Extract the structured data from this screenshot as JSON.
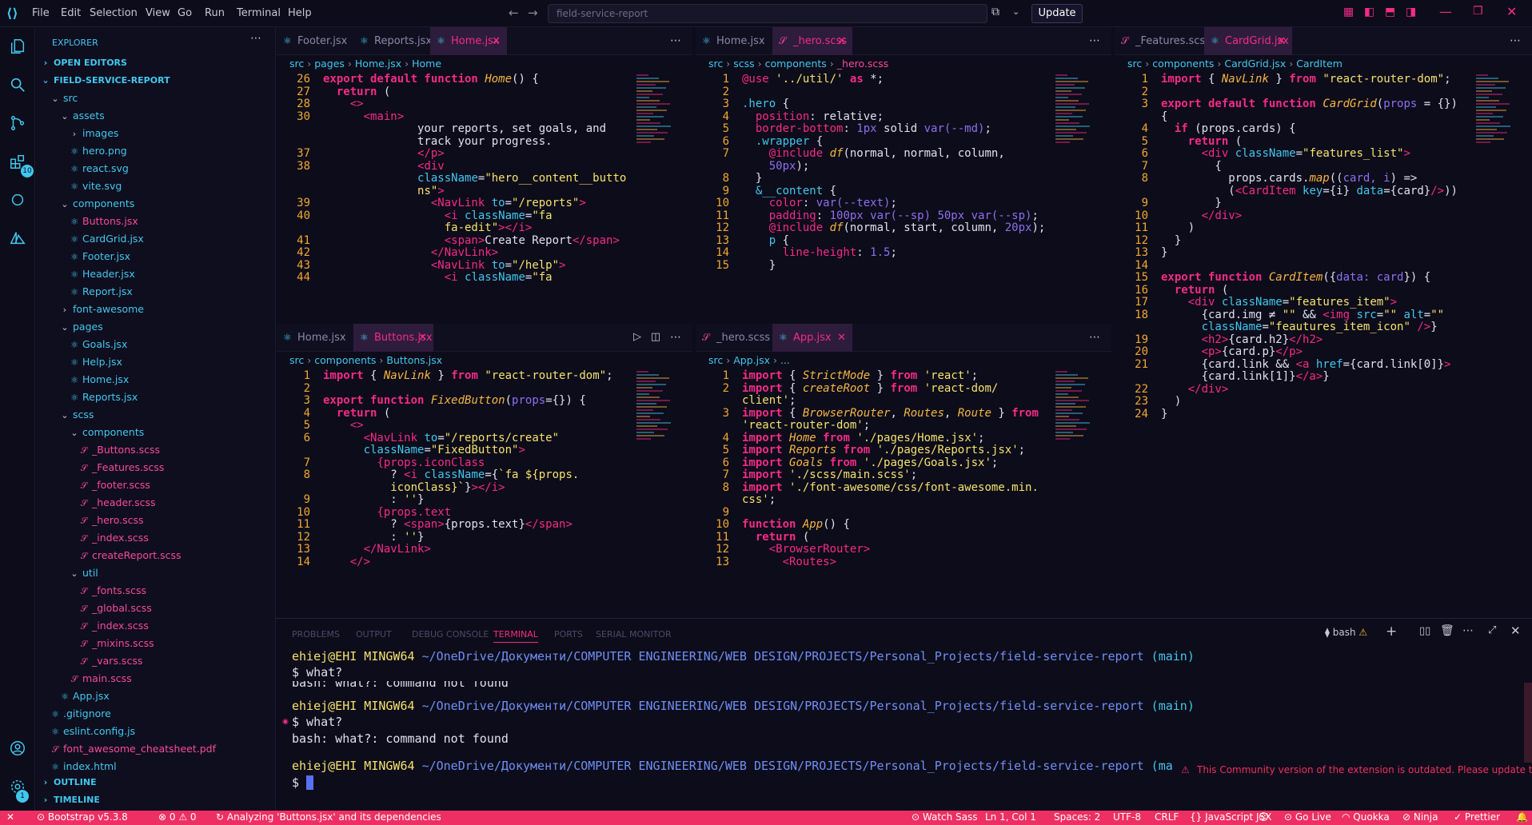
{
  "menu": [
    "File",
    "Edit",
    "Selection",
    "View",
    "Go",
    "Run",
    "Terminal",
    "Help"
  ],
  "search_placeholder": "field-service-report",
  "update_label": "Update",
  "explorer": {
    "title": "EXPLORER",
    "open_editors": "OPEN EDITORS",
    "project": "FIELD-SERVICE-REPORT",
    "items": [
      {
        "label": "src",
        "type": "folder",
        "open": true,
        "depth": 1
      },
      {
        "label": "assets",
        "type": "folder",
        "open": true,
        "depth": 2
      },
      {
        "label": "images",
        "type": "folder",
        "open": false,
        "depth": 3
      },
      {
        "label": "hero.png",
        "type": "file",
        "depth": 3
      },
      {
        "label": "react.svg",
        "type": "file",
        "depth": 3
      },
      {
        "label": "vite.svg",
        "type": "file",
        "depth": 3
      },
      {
        "label": "components",
        "type": "folder",
        "open": true,
        "depth": 2
      },
      {
        "label": "Buttons.jsx",
        "type": "active",
        "depth": 3
      },
      {
        "label": "CardGrid.jsx",
        "type": "file",
        "depth": 3
      },
      {
        "label": "Footer.jsx",
        "type": "file",
        "depth": 3
      },
      {
        "label": "Header.jsx",
        "type": "file",
        "depth": 3
      },
      {
        "label": "Report.jsx",
        "type": "file",
        "depth": 3
      },
      {
        "label": "font-awesome",
        "type": "folder",
        "open": false,
        "depth": 2
      },
      {
        "label": "pages",
        "type": "folder",
        "open": true,
        "depth": 2
      },
      {
        "label": "Goals.jsx",
        "type": "file",
        "depth": 3
      },
      {
        "label": "Help.jsx",
        "type": "file",
        "depth": 3
      },
      {
        "label": "Home.jsx",
        "type": "file",
        "depth": 3
      },
      {
        "label": "Reports.jsx",
        "type": "file",
        "depth": 3
      },
      {
        "label": "scss",
        "type": "folder",
        "open": true,
        "depth": 2
      },
      {
        "label": "components",
        "type": "folder",
        "open": true,
        "depth": 3
      },
      {
        "label": "_Buttons.scss",
        "type": "scss",
        "depth": 4
      },
      {
        "label": "_Features.scss",
        "type": "scss",
        "depth": 4
      },
      {
        "label": "_footer.scss",
        "type": "scss",
        "depth": 4
      },
      {
        "label": "_header.scss",
        "type": "scss",
        "depth": 4
      },
      {
        "label": "_hero.scss",
        "type": "scss",
        "depth": 4
      },
      {
        "label": "_index.scss",
        "type": "scss",
        "depth": 4
      },
      {
        "label": "createReport.scss",
        "type": "scss",
        "depth": 4
      },
      {
        "label": "util",
        "type": "folder",
        "open": true,
        "depth": 3
      },
      {
        "label": "_fonts.scss",
        "type": "scss",
        "depth": 4
      },
      {
        "label": "_global.scss",
        "type": "scss",
        "depth": 4
      },
      {
        "label": "_index.scss",
        "type": "scss",
        "depth": 4
      },
      {
        "label": "_mixins.scss",
        "type": "scss",
        "depth": 4
      },
      {
        "label": "_vars.scss",
        "type": "scss",
        "depth": 4
      },
      {
        "label": "main.scss",
        "type": "scss",
        "depth": 3
      },
      {
        "label": "App.jsx",
        "type": "file",
        "depth": 2
      },
      {
        "label": ".gitignore",
        "type": "file",
        "depth": 1
      },
      {
        "label": "eslint.config.js",
        "type": "file",
        "depth": 1
      },
      {
        "label": "font_awesome_cheatsheet.pdf",
        "type": "scss",
        "depth": 1
      },
      {
        "label": "index.html",
        "type": "file",
        "depth": 1
      }
    ],
    "outline": "OUTLINE",
    "timeline": "TIMELINE"
  },
  "panes": {
    "top_left": {
      "tabs": [
        {
          "label": "Footer.jsx"
        },
        {
          "label": "Reports.jsx"
        },
        {
          "label": "Home.jsx",
          "active": true
        }
      ],
      "crumb": [
        "src",
        "pages",
        "Home.jsx",
        "Home"
      ],
      "lines": [
        {
          "n": "26",
          "html": "<span class='kw'>export default function</span> <span class='fn'>Home</span>() {"
        },
        {
          "n": "27",
          "html": "  <span class='kw'>return</span> ("
        },
        {
          "n": "28",
          "html": "    <span class='tag'>&lt;&gt;</span>"
        },
        {
          "n": "30",
          "html": "      <span class='tag'>&lt;main&gt;</span>"
        },
        {
          "n": "",
          "html": "              your reports, set goals, and"
        },
        {
          "n": "",
          "html": "              track your progress."
        },
        {
          "n": "37",
          "html": "              <span class='tag'>&lt;/p&gt;</span>"
        },
        {
          "n": "38",
          "html": "              <span class='tag'>&lt;div</span>"
        },
        {
          "n": "",
          "html": "              <span class='attr'>className</span>=<span class='str'>\"hero__content__butto</span>"
        },
        {
          "n": "",
          "html": "              <span class='str'>ns\"</span><span class='tag'>&gt;</span>"
        },
        {
          "n": "39",
          "html": "                <span class='tag'>&lt;NavLink</span> <span class='attr'>to</span>=<span class='str'>\"/reports\"</span><span class='tag'>&gt;</span>"
        },
        {
          "n": "40",
          "html": "                  <span class='tag'>&lt;i</span> <span class='attr'>className</span>=<span class='str'>\"fa</span>"
        },
        {
          "n": "",
          "html": "                  <span class='str'>fa-edit\"</span><span class='tag'>&gt;&lt;/i&gt;</span>"
        },
        {
          "n": "41",
          "html": "                  <span class='tag'>&lt;span&gt;</span>Create Report<span class='tag'>&lt;/span&gt;</span>"
        },
        {
          "n": "42",
          "html": "                <span class='tag'>&lt;/NavLink&gt;</span>"
        },
        {
          "n": "43",
          "html": "                <span class='tag'>&lt;NavLink</span> <span class='attr'>to</span>=<span class='str'>\"/help\"</span><span class='tag'>&gt;</span>"
        },
        {
          "n": "44",
          "html": "                  <span class='tag'>&lt;i</span> <span class='attr'>className</span>=<span class='str'>\"fa</span>"
        }
      ]
    },
    "top_mid": {
      "tabs": [
        {
          "label": "Home.jsx"
        },
        {
          "label": "_hero.scss",
          "active": true
        }
      ],
      "crumb": [
        "src",
        "scss",
        "components",
        "_hero.scss"
      ],
      "lines": [
        {
          "n": "1",
          "html": "<span class='prop'>@use</span> <span class='str'>'../util/'</span> <span class='kw'>as</span> *;"
        },
        {
          "n": "2",
          "html": ""
        },
        {
          "n": "3",
          "html": "<span class='attr'>.hero</span> {"
        },
        {
          "n": "4",
          "html": "  <span class='prop'>position</span>: relative;"
        },
        {
          "n": "5",
          "html": "  <span class='prop'>border-bottom</span>: <span class='var'>1px</span> solid <span class='var'>var(--md)</span>;"
        },
        {
          "n": "6",
          "html": "  <span class='attr'>.wrapper</span> {"
        },
        {
          "n": "7",
          "html": "    <span class='prop'>@include</span> <span class='fn'>df</span>(normal, normal, column,"
        },
        {
          "n": "",
          "html": "    <span class='var'>50px</span>);"
        },
        {
          "n": "8",
          "html": "  }"
        },
        {
          "n": "9",
          "html": "  <span class='attr'>&amp;__content</span> {"
        },
        {
          "n": "10",
          "html": "    <span class='prop'>color</span>: <span class='var'>var(--text)</span>;"
        },
        {
          "n": "11",
          "html": "    <span class='prop'>padding</span>: <span class='var'>100px var(--sp) 50px var(--sp)</span>;"
        },
        {
          "n": "12",
          "html": "    <span class='prop'>@include</span> <span class='fn'>df</span>(normal, start, column, <span class='var'>20px</span>);"
        },
        {
          "n": "13",
          "html": "    <span class='attr'>p</span> {"
        },
        {
          "n": "14",
          "html": "      <span class='prop'>line-height</span>: <span class='var'>1.5</span>;"
        },
        {
          "n": "15",
          "html": "    }"
        }
      ]
    },
    "right": {
      "tabs": [
        {
          "label": "_Features.scss"
        },
        {
          "label": "CardGrid.jsx",
          "active": true
        }
      ],
      "crumb": [
        "src",
        "components",
        "CardGrid.jsx",
        "CardItem"
      ],
      "lines": [
        {
          "n": "1",
          "html": "<span class='kw'>import</span> { <span class='fn'>NavLink</span> } <span class='kw'>from</span> <span class='str'>\"react-router-dom\"</span>;"
        },
        {
          "n": "2",
          "html": ""
        },
        {
          "n": "3",
          "html": "<span class='kw'>export default function</span> <span class='fn'>CardGrid</span>(<span class='var'>props</span> = {})"
        },
        {
          "n": "",
          "html": "{"
        },
        {
          "n": "4",
          "html": "  <span class='kw'>if</span> (props.cards) {"
        },
        {
          "n": "5",
          "html": "    <span class='kw'>return</span> ("
        },
        {
          "n": "6",
          "html": "      <span class='tag'>&lt;div</span> <span class='attr'>className</span>=<span class='str'>\"features_list\"</span><span class='tag'>&gt;</span>"
        },
        {
          "n": "7",
          "html": "        {"
        },
        {
          "n": "8",
          "html": "          props.cards.<span class='fn'>map</span>((<span class='var'>card, i</span>) =&gt;"
        },
        {
          "n": "",
          "html": "          (<span class='tag'>&lt;CardItem</span> <span class='attr'>key</span>={i} <span class='attr'>data</span>={card}<span class='tag'>/&gt;</span>))"
        },
        {
          "n": "9",
          "html": "        }"
        },
        {
          "n": "10",
          "html": "      <span class='tag'>&lt;/div&gt;</span>"
        },
        {
          "n": "11",
          "html": "    )"
        },
        {
          "n": "12",
          "html": "  }"
        },
        {
          "n": "13",
          "html": "}"
        },
        {
          "n": "14",
          "html": ""
        },
        {
          "n": "15",
          "html": "<span class='kw'>export function</span> <span class='fn'>CardItem</span>({<span class='var'>data: card</span>}) {"
        },
        {
          "n": "16",
          "html": "  <span class='kw'>return</span> ("
        },
        {
          "n": "17",
          "html": "    <span class='tag'>&lt;div</span> <span class='attr'>className</span>=<span class='str'>\"features_item\"</span><span class='tag'>&gt;</span>"
        },
        {
          "n": "18",
          "html": "      {card.img &#8800; <span class='str'>\"\"</span> &amp;&amp; <span class='tag'>&lt;img</span> <span class='attr'>src</span>=<span class='str'>\"\"</span> <span class='attr'>alt</span>=<span class='str'>\"\"</span>"
        },
        {
          "n": "",
          "html": "      <span class='attr'>className</span>=<span class='str'>\"feautures_item_icon\"</span> <span class='tag'>/&gt;</span>}"
        },
        {
          "n": "19",
          "html": "      <span class='tag'>&lt;h2&gt;</span>{card.h2}<span class='tag'>&lt;/h2&gt;</span>"
        },
        {
          "n": "20",
          "html": "      <span class='tag'>&lt;p&gt;</span>{card.p}<span class='tag'>&lt;/p&gt;</span>"
        },
        {
          "n": "21",
          "html": "      {card.link &amp;&amp; <span class='tag'>&lt;a</span> <span class='attr'>href</span>={card.link[0]}<span class='tag'>&gt;</span>"
        },
        {
          "n": "",
          "html": "      {card.link[1]}<span class='tag'>&lt;/a&gt;</span>}"
        },
        {
          "n": "22",
          "html": "    <span class='tag'>&lt;/div&gt;</span>"
        },
        {
          "n": "23",
          "html": "  )"
        },
        {
          "n": "24",
          "html": "}"
        }
      ]
    },
    "bot_left": {
      "tabs": [
        {
          "label": "Home.jsx"
        },
        {
          "label": "Buttons.jsx",
          "active": true
        }
      ],
      "crumb": [
        "src",
        "components",
        "Buttons.jsx"
      ],
      "lines": [
        {
          "n": "1",
          "html": "<span class='kw'>import</span> { <span class='fn'>NavLink</span> } <span class='kw'>from</span> <span class='str'>\"react-router-dom\"</span>;"
        },
        {
          "n": "2",
          "html": ""
        },
        {
          "n": "3",
          "html": "<span class='kw'>export function</span> <span class='fn'>FixedButton</span>(<span class='var'>props</span>={}) {"
        },
        {
          "n": "4",
          "html": "  <span class='kw'>return</span> ("
        },
        {
          "n": "5",
          "html": "    <span class='tag'>&lt;&gt;</span>"
        },
        {
          "n": "6",
          "html": "      <span class='tag'>&lt;NavLink</span> <span class='attr'>to</span>=<span class='str'>\"/reports/create\"</span>"
        },
        {
          "n": "",
          "html": "      <span class='attr'>className</span>=<span class='str'>\"FixedButton\"</span><span class='tag'>&gt;</span>"
        },
        {
          "n": "7",
          "html": "        <span class='tag'>{props.iconClass</span>"
        },
        {
          "n": "8",
          "html": "          ? <span class='tag'>&lt;i</span> <span class='attr'>className</span>={<span class='str'>`fa ${props.</span>"
        },
        {
          "n": "",
          "html": "          <span class='str'>iconClass}`</span>}<span class='tag'>&gt;&lt;/i&gt;</span>"
        },
        {
          "n": "9",
          "html": "          : <span class='str'>''</span>}"
        },
        {
          "n": "10",
          "html": "        <span class='tag'>{props.text</span>"
        },
        {
          "n": "11",
          "html": "          ? <span class='tag'>&lt;span&gt;</span>{props.text}<span class='tag'>&lt;/span&gt;</span>"
        },
        {
          "n": "12",
          "html": "          : <span class='str'>''</span>}"
        },
        {
          "n": "13",
          "html": "      <span class='tag'>&lt;/NavLink&gt;</span>"
        },
        {
          "n": "14",
          "html": "    <span class='tag'>&lt;/&gt;</span>"
        }
      ]
    },
    "bot_mid": {
      "tabs": [
        {
          "label": "_hero.scss"
        },
        {
          "label": "App.jsx",
          "active": true
        }
      ],
      "crumb": [
        "src",
        "App.jsx",
        "..."
      ],
      "lines": [
        {
          "n": "1",
          "html": "<span class='kw'>import</span> { <span class='fn'>StrictMode</span> } <span class='kw'>from</span> <span class='str'>'react'</span>;"
        },
        {
          "n": "2",
          "html": "<span class='kw'>import</span> { <span class='fn'>createRoot</span> } <span class='kw'>from</span> <span class='str'>'react-dom/</span>"
        },
        {
          "n": "",
          "html": "<span class='str'>client'</span>;"
        },
        {
          "n": "3",
          "html": "<span class='kw'>import</span> { <span class='fn'>BrowserRouter</span>, <span class='fn'>Routes</span>, <span class='fn'>Route</span> } <span class='kw'>from</span>"
        },
        {
          "n": "",
          "html": "<span class='str'>'react-router-dom'</span>;"
        },
        {
          "n": "4",
          "html": "<span class='kw'>import</span> <span class='fn'>Home</span> <span class='kw'>from</span> <span class='str'>'./pages/Home.jsx'</span>;"
        },
        {
          "n": "5",
          "html": "<span class='kw'>import</span> <span class='fn'>Reports</span> <span class='kw'>from</span> <span class='str'>'./pages/Reports.jsx'</span>;"
        },
        {
          "n": "6",
          "html": "<span class='kw'>import</span> <span class='fn'>Goals</span> <span class='kw'>from</span> <span class='str'>'./pages/Goals.jsx'</span>;"
        },
        {
          "n": "7",
          "html": "<span class='kw'>import</span> <span class='str'>'./scss/main.scss'</span>;"
        },
        {
          "n": "8",
          "html": "<span class='kw'>import</span> <span class='str'>'./font-awesome/css/font-awesome.min.</span>"
        },
        {
          "n": "",
          "html": "<span class='str'>css'</span>;"
        },
        {
          "n": "9",
          "html": ""
        },
        {
          "n": "10",
          "html": "<span class='kw'>function</span> <span class='fn'>App</span>() {"
        },
        {
          "n": "11",
          "html": "  <span class='kw'>return</span> ("
        },
        {
          "n": "12",
          "html": "    <span class='tag'>&lt;BrowserRouter&gt;</span>"
        },
        {
          "n": "13",
          "html": "      <span class='tag'>&lt;Routes&gt;</span>"
        }
      ]
    }
  },
  "panel": {
    "tabs": [
      "PROBLEMS",
      "OUTPUT",
      "DEBUG CONSOLE",
      "TERMINAL",
      "PORTS",
      "SERIAL MONITOR"
    ],
    "active_tab": "TERMINAL",
    "shell": "bash",
    "prompt_user": "ehiej@EHI MINGW64",
    "prompt_path": "~/OneDrive/Документи/COMPUTER ENGINEERING/WEB DESIGN/PROJECTS/Personal_Projects/field-service-report",
    "branch": "(main)",
    "branch_cut": "(ma",
    "cmd": "$ what?",
    "err": "bash: what?: command not found",
    "prompt_end": "$",
    "notice": "This Community version of the extension is outdated. Please update to..."
  },
  "status": {
    "bootstrap": "Bootstrap v5.3.8",
    "errors": "0",
    "warnings": "0",
    "analyzing": "Analyzing 'Buttons.jsx' and its dependencies",
    "watch_sass": "Watch Sass",
    "position": "Ln 1, Col 1",
    "spaces": "Spaces: 2",
    "encoding": "UTF-8",
    "eol": "CRLF",
    "language": "JavaScript JSX",
    "go_live": "Go Live",
    "quokka": "Quokka",
    "ninja": "Ninja",
    "prettier": "Prettier"
  },
  "colors": {
    "accent": "#f22c86",
    "status_bg": "#ee2f63",
    "cyan": "#41c7ee",
    "bg": "#0d0c1a"
  }
}
